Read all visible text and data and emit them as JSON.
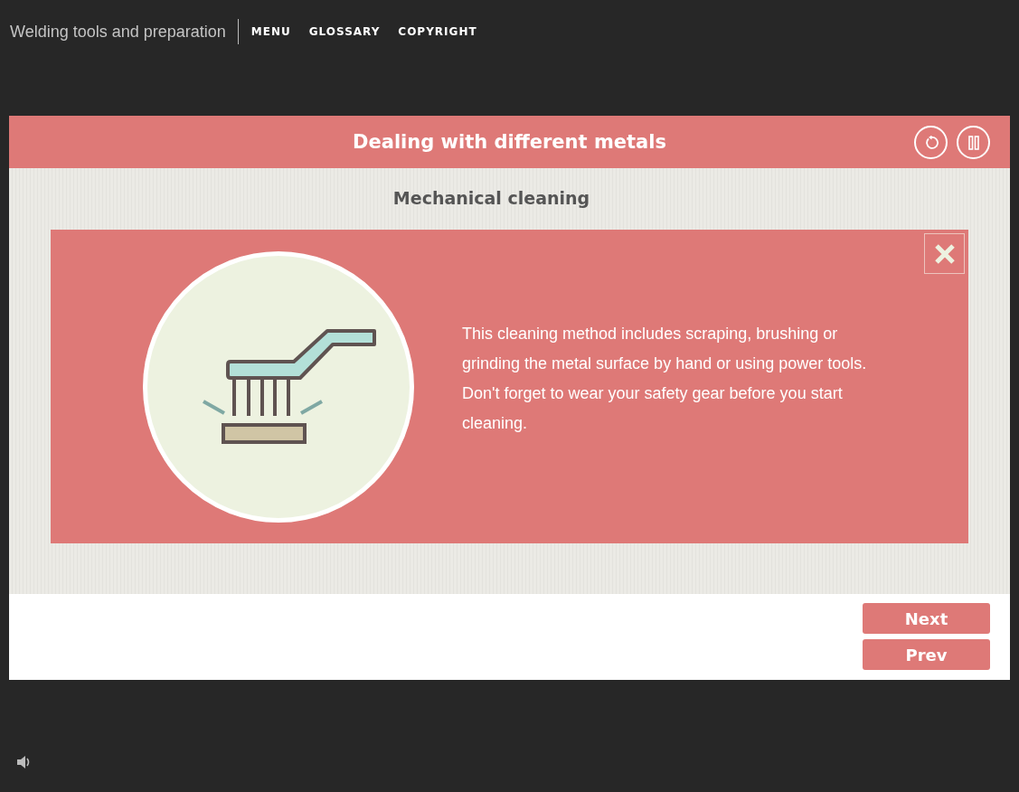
{
  "course_title": "Welding tools and preparation",
  "nav": [
    "MENU",
    "GLOSSARY",
    "COPYRIGHT"
  ],
  "slide": {
    "title": "Dealing with different metals",
    "subtitle": "Mechanical cleaning",
    "popup": {
      "text": "This cleaning method includes scraping, brushing or grinding the metal surface by hand or using power tools. Don't forget to wear your safety gear before you start cleaning."
    }
  },
  "buttons": [
    "Next",
    "Prev"
  ]
}
